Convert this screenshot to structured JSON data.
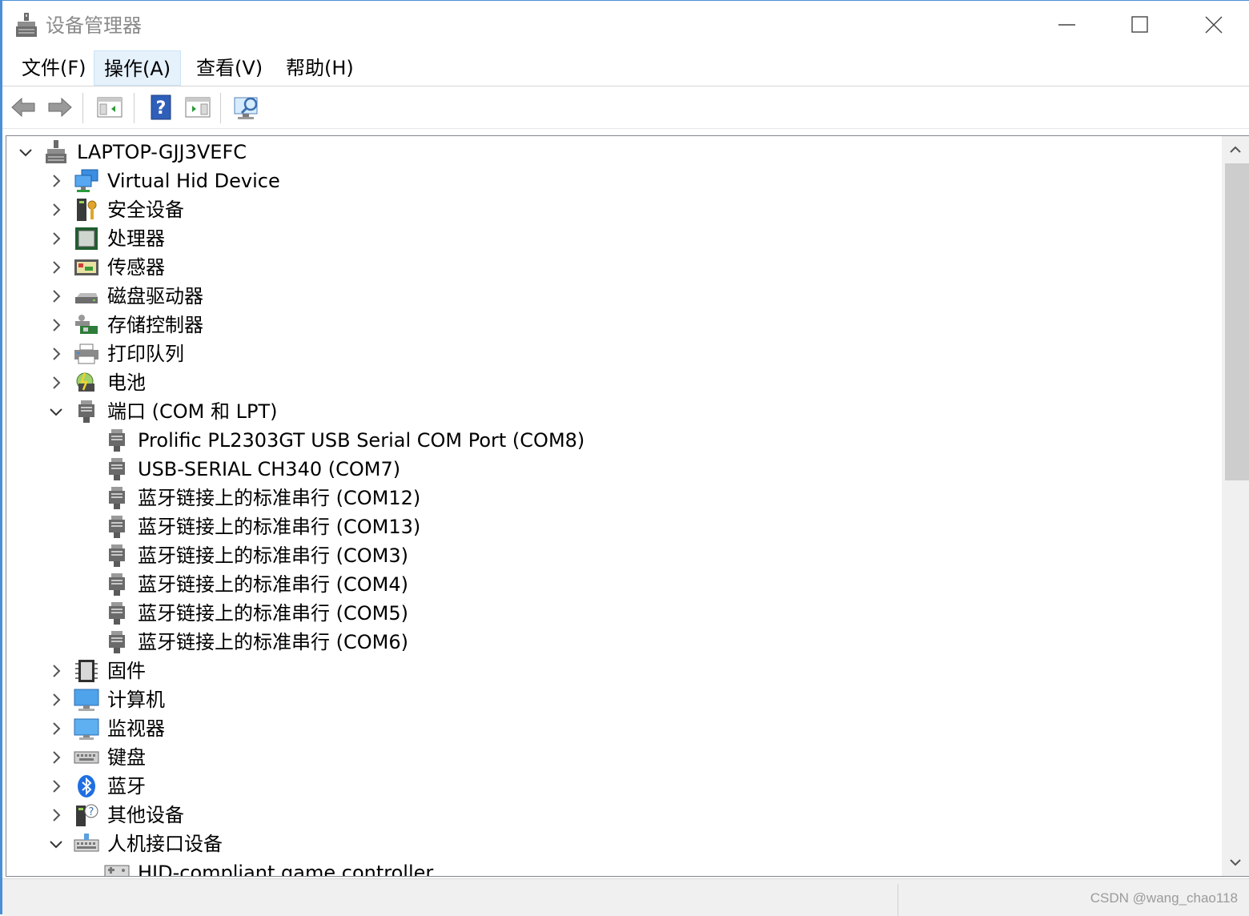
{
  "window": {
    "title": "设备管理器",
    "controls": {
      "minimize": "minimize-icon",
      "maximize": "maximize-icon",
      "close": "close-icon"
    }
  },
  "menu": [
    {
      "label": "文件(F)"
    },
    {
      "label": "操作(A)",
      "active": true
    },
    {
      "label": "查看(V)"
    },
    {
      "label": "帮助(H)"
    }
  ],
  "toolbar": {
    "buttons": [
      "back-icon",
      "forward-icon",
      "show-hide-console-tree-icon",
      "help-icon",
      "action-pane-icon",
      "scan-hardware-icon"
    ]
  },
  "tree": {
    "root": {
      "label": "LAPTOP-GJJ3VEFC",
      "expanded": true,
      "icon": "computer-tower-icon"
    },
    "items": [
      {
        "label": "Virtual Hid Device",
        "level": 1,
        "expanded": false,
        "icon": "network-monitor-icon"
      },
      {
        "label": "安全设备",
        "level": 1,
        "expanded": false,
        "icon": "security-key-icon"
      },
      {
        "label": "处理器",
        "level": 1,
        "expanded": false,
        "icon": "processor-chip-icon"
      },
      {
        "label": "传感器",
        "level": 1,
        "expanded": false,
        "icon": "sensor-icon"
      },
      {
        "label": "磁盘驱动器",
        "level": 1,
        "expanded": false,
        "icon": "disk-drive-icon"
      },
      {
        "label": "存储控制器",
        "level": 1,
        "expanded": false,
        "icon": "storage-controller-icon"
      },
      {
        "label": "打印队列",
        "level": 1,
        "expanded": false,
        "icon": "printer-icon"
      },
      {
        "label": "电池",
        "level": 1,
        "expanded": false,
        "icon": "battery-icon"
      },
      {
        "label": "端口 (COM 和 LPT)",
        "level": 1,
        "expanded": true,
        "icon": "port-icon"
      },
      {
        "label": "Prolific PL2303GT USB Serial COM Port (COM8)",
        "level": 2,
        "icon": "port-icon"
      },
      {
        "label": "USB-SERIAL CH340 (COM7)",
        "level": 2,
        "icon": "port-icon"
      },
      {
        "label": "蓝牙链接上的标准串行 (COM12)",
        "level": 2,
        "icon": "port-icon"
      },
      {
        "label": "蓝牙链接上的标准串行 (COM13)",
        "level": 2,
        "icon": "port-icon"
      },
      {
        "label": "蓝牙链接上的标准串行 (COM3)",
        "level": 2,
        "icon": "port-icon"
      },
      {
        "label": "蓝牙链接上的标准串行 (COM4)",
        "level": 2,
        "icon": "port-icon"
      },
      {
        "label": "蓝牙链接上的标准串行 (COM5)",
        "level": 2,
        "icon": "port-icon"
      },
      {
        "label": "蓝牙链接上的标准串行 (COM6)",
        "level": 2,
        "icon": "port-icon"
      },
      {
        "label": "固件",
        "level": 1,
        "expanded": false,
        "icon": "firmware-chip-icon"
      },
      {
        "label": "计算机",
        "level": 1,
        "expanded": false,
        "icon": "computer-monitor-icon"
      },
      {
        "label": "监视器",
        "level": 1,
        "expanded": false,
        "icon": "monitor-icon"
      },
      {
        "label": "键盘",
        "level": 1,
        "expanded": false,
        "icon": "keyboard-icon"
      },
      {
        "label": "蓝牙",
        "level": 1,
        "expanded": false,
        "icon": "bluetooth-icon"
      },
      {
        "label": "其他设备",
        "level": 1,
        "expanded": false,
        "icon": "unknown-device-icon"
      },
      {
        "label": "人机接口设备",
        "level": 1,
        "expanded": true,
        "icon": "hid-keyboard-icon"
      },
      {
        "label": "HID-compliant game controller",
        "level": 2,
        "icon": "game-controller-icon"
      }
    ]
  },
  "statusbar": {
    "watermark": "CSDN @wang_chao118"
  },
  "colors": {
    "accent": "#4a8fd6",
    "menu_active_bg": "#e5f1fb",
    "scrollbar_thumb": "#cdcdcd",
    "status_bg": "#f0f0f0"
  }
}
